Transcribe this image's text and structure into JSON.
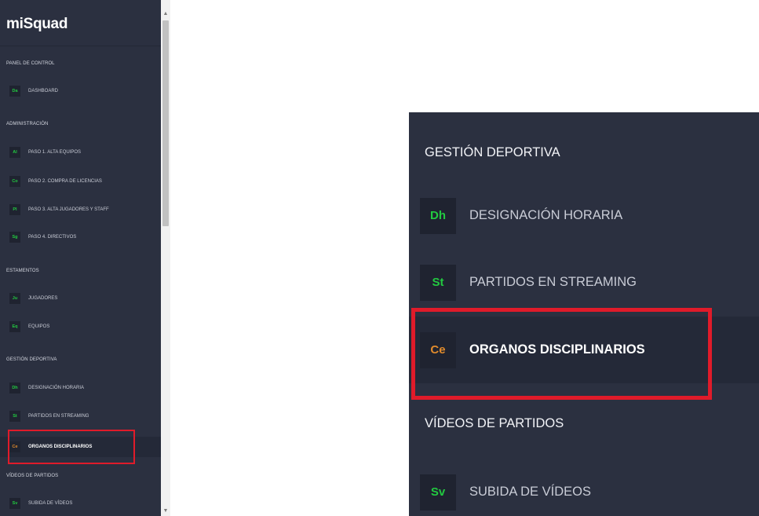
{
  "brand": "miSquad",
  "sidebar": {
    "sections": [
      {
        "title": "PANEL DE CONTROL",
        "items": [
          {
            "badge": "Da",
            "label": "DASHBOARD"
          }
        ]
      },
      {
        "title": "ADMINISTRACIÓN",
        "items": [
          {
            "badge": "Al",
            "label": "PASO 1. ALTA EQUIPOS"
          },
          {
            "badge": "Co",
            "label": "PASO 2. COMPRA DE LICENCIAS"
          },
          {
            "badge": "Pl",
            "label": "PASO 3. ALTA JUGADORES Y STAFF"
          },
          {
            "badge": "Sg",
            "label": "PASO 4. DIRECTIVOS"
          }
        ]
      },
      {
        "title": "ESTAMENTOS",
        "items": [
          {
            "badge": "Ju",
            "label": "JUGADORES"
          },
          {
            "badge": "Eq",
            "label": "EQUIPOS"
          }
        ]
      },
      {
        "title": "GESTIÓN DEPORTIVA",
        "items": [
          {
            "badge": "Dh",
            "label": "DESIGNACIÓN HORARIA"
          },
          {
            "badge": "St",
            "label": "PARTIDOS EN STREAMING"
          },
          {
            "badge": "Ce",
            "label": "ORGANOS DISCIPLINARIOS",
            "active": true
          }
        ]
      },
      {
        "title": "VÍDEOS DE PARTIDOS",
        "items": [
          {
            "badge": "Sv",
            "label": "SUBIDA DE VÍDEOS"
          }
        ]
      }
    ]
  },
  "zoom": {
    "section_gestion": "GESTIÓN DEPORTIVA",
    "items": [
      {
        "badge": "Dh",
        "label": "DESIGNACIÓN HORARIA"
      },
      {
        "badge": "St",
        "label": "PARTIDOS EN STREAMING"
      },
      {
        "badge": "Ce",
        "label": "ORGANOS DISCIPLINARIOS",
        "active": true
      }
    ],
    "section_videos": "VÍDEOS DE PARTIDOS",
    "video_item": {
      "badge": "Sv",
      "label": "SUBIDA DE VÍDEOS"
    }
  },
  "scrollbar": {
    "up_icon": "chevron-up-icon",
    "down_icon": "chevron-down-icon"
  },
  "colors": {
    "sidebar_bg": "#2b3040",
    "badge_bg": "#1f2330",
    "badge_green": "#22c940",
    "badge_orange_active": "#e08b2c",
    "highlight_red": "#e01b2a"
  }
}
